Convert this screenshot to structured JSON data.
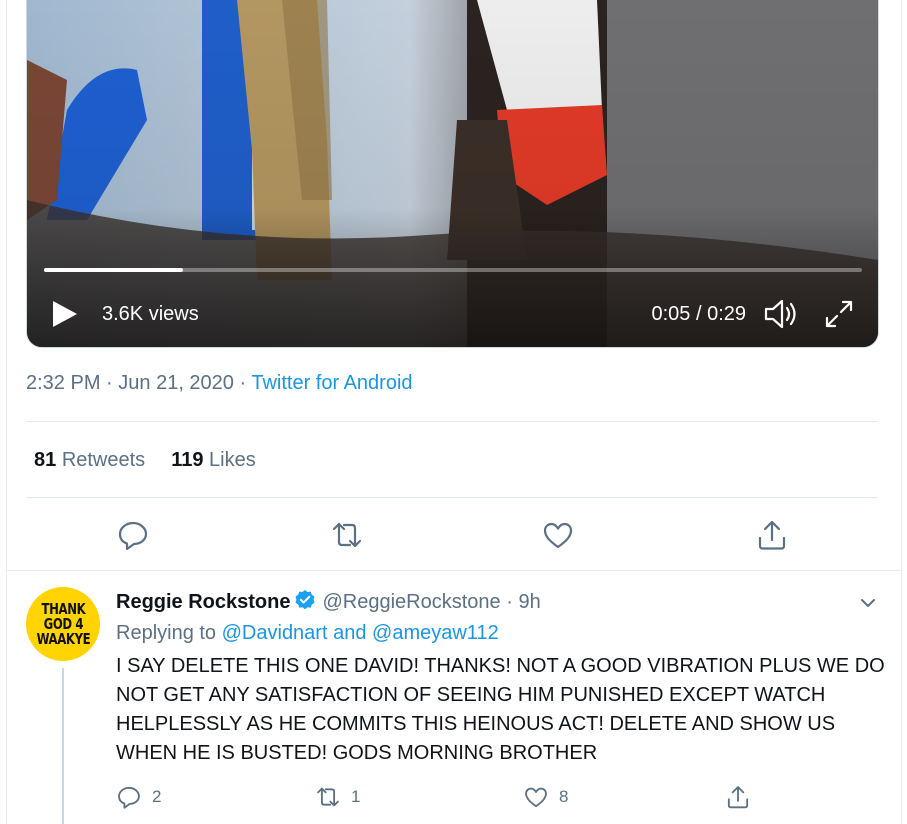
{
  "video": {
    "views": "3.6K views",
    "time": "0:05 / 0:29",
    "progress": 0.17
  },
  "meta": {
    "time": "2:32 PM",
    "sep1": " · ",
    "date": "Jun 21, 2020",
    "sep2": " · ",
    "source": "Twitter for Android"
  },
  "stats": {
    "retweets_count": "81",
    "retweets_label": "Retweets",
    "likes_count": "119",
    "likes_label": "Likes"
  },
  "actions": [
    "reply-icon",
    "retweet-icon",
    "like-icon",
    "share-icon"
  ],
  "reply": {
    "avatar_lines": [
      "THANK",
      "GOD 4",
      "WAAKYE"
    ],
    "name": "Reggie Rockstone",
    "handle": "@ReggieRockstone",
    "dot": " · ",
    "time": "9h",
    "replying_prefix": "Replying to",
    "mention1": "@Davidnart",
    "and": "and",
    "mention2": "@ameyaw112",
    "text": "I SAY DELETE THIS ONE DAVID! THANKS! NOT A GOOD VIBRATION PLUS WE DO NOT GET ANY SATISFACTION OF SEEING HIM PUNISHED EXCEPT WATCH HELPLESSLY AS HE COMMITS THIS HEINOUS ACT! DELETE AND SHOW US WHEN HE IS BUSTED! GODS MORNING BROTHER",
    "replies": "2",
    "retweets": "1",
    "likes": "8"
  },
  "colors": {
    "link": "#1b95e0",
    "muted": "#5b7083",
    "verified": "#1da1f2",
    "avatar_bg": "#ffd400"
  }
}
